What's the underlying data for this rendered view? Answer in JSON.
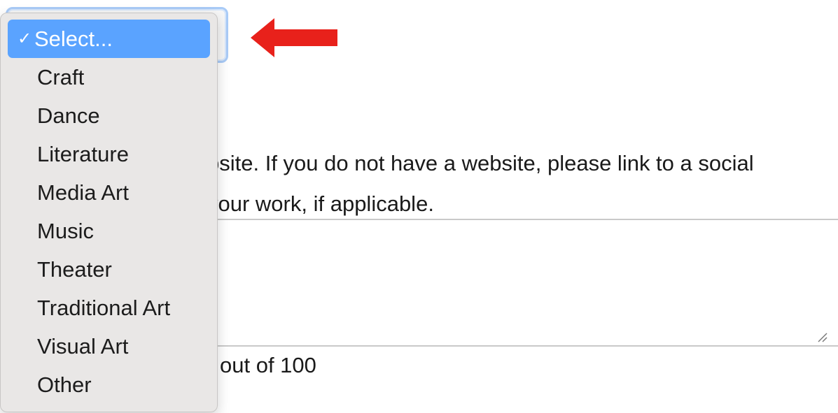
{
  "help_text": {
    "line1": "bsite. If you do not have a website, please link to a social",
    "line2": "your work, if applicable."
  },
  "char_counter": "out of 100",
  "dropdown": {
    "selected_check": "✓",
    "options": [
      {
        "label": "Select...",
        "selected": true
      },
      {
        "label": "Craft",
        "selected": false
      },
      {
        "label": "Dance",
        "selected": false
      },
      {
        "label": "Literature",
        "selected": false
      },
      {
        "label": "Media Art",
        "selected": false
      },
      {
        "label": "Music",
        "selected": false
      },
      {
        "label": "Theater",
        "selected": false
      },
      {
        "label": "Traditional Art",
        "selected": false
      },
      {
        "label": "Visual Art",
        "selected": false
      },
      {
        "label": "Other",
        "selected": false
      }
    ]
  },
  "colors": {
    "highlight": "#5aa3ff",
    "arrow": "#e8211b",
    "menu_background": "#e9e7e6"
  },
  "icons": {
    "arrow": "red-left-arrow",
    "check": "checkmark-icon",
    "chevron": "chevron-down-icon",
    "resize": "resize-handle-icon"
  }
}
